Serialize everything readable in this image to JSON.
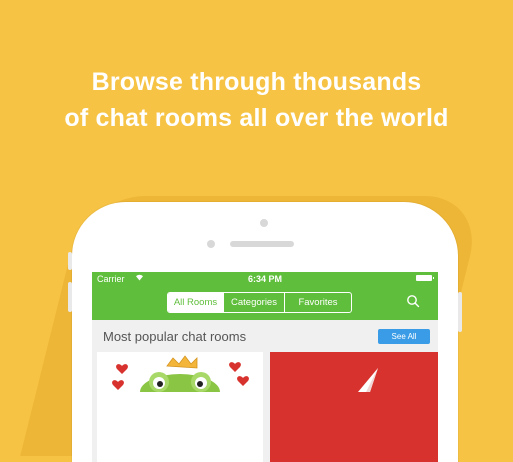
{
  "headline": {
    "line1": "Browse through thousands",
    "line2": "of chat rooms all over the  world"
  },
  "status_bar": {
    "carrier": "Carrier",
    "time": "6:34 PM"
  },
  "tabs": [
    {
      "label": "All Rooms",
      "active": true
    },
    {
      "label": "Categories",
      "active": false
    },
    {
      "label": "Favorites",
      "active": false
    }
  ],
  "section": {
    "title": "Most popular chat rooms",
    "see_all": "See All"
  },
  "colors": {
    "background": "#f6c344",
    "nav": "#5fbe3b",
    "see_all": "#3a9ce6",
    "card_red": "#d8322e"
  },
  "icons": [
    "wifi-icon",
    "battery-icon",
    "search-icon",
    "heart-icon",
    "crown-icon",
    "frog-icon"
  ]
}
